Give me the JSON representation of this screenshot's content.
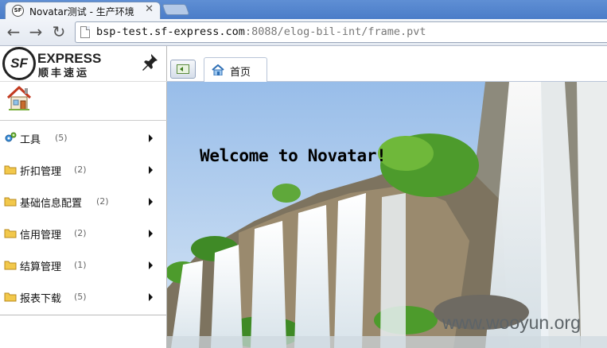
{
  "browser": {
    "tab_title": "Novatar测试 - 生产环境",
    "tab_favicon_text": "SF",
    "close_symbol": "✕",
    "url_host": "bsp-test.sf-express.com",
    "url_rest": ":8088/elog-bil-int/frame.pvt",
    "back_symbol": "←",
    "forward_symbol": "→",
    "reload_symbol": "↻"
  },
  "sidebar": {
    "logo_mark": "SF",
    "logo_en": "EXPRESS",
    "logo_zh": "顺丰速运",
    "items": [
      {
        "label": "工具",
        "count": "(5)",
        "icon": "tools-icon"
      },
      {
        "label": "折扣管理",
        "count": "(2)",
        "icon": "folder-icon"
      },
      {
        "label": "基础信息配置",
        "count": "(2)",
        "icon": "folder-icon"
      },
      {
        "label": "信用管理",
        "count": "(2)",
        "icon": "folder-icon"
      },
      {
        "label": "结算管理",
        "count": "(1)",
        "icon": "folder-icon"
      },
      {
        "label": "报表下载",
        "count": "(5)",
        "icon": "folder-icon"
      }
    ]
  },
  "content": {
    "tab_label": "首页",
    "welcome": "Welcome to Novatar!",
    "watermark": "www.wooyun.org"
  },
  "colors": {
    "sky": "#a9c6ea",
    "folder": "#f2c84b",
    "chrome_blue": "#4a7cc8"
  }
}
